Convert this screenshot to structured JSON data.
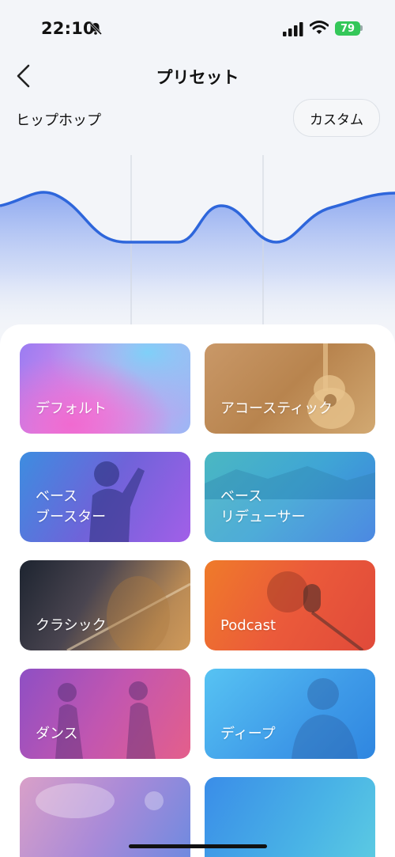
{
  "status_bar": {
    "time": "22:10",
    "battery": "79"
  },
  "nav": {
    "title": "プリセット"
  },
  "preset": {
    "current_name": "ヒップホップ",
    "custom_label": "カスタム"
  },
  "presets": [
    {
      "label": "デフォルト"
    },
    {
      "label": "アコースティック"
    },
    {
      "label": "ベース\nブースター"
    },
    {
      "label": "ベース\nリデューサー"
    },
    {
      "label": "クラシック"
    },
    {
      "label": "Podcast"
    },
    {
      "label": "ダンス"
    },
    {
      "label": "ディープ"
    }
  ],
  "colors": {
    "accent": "#2e66db",
    "battery": "#34c759"
  },
  "icons": [
    "bell-slash-icon",
    "cellular-signal-icon",
    "wifi-icon",
    "back-chevron-icon"
  ]
}
